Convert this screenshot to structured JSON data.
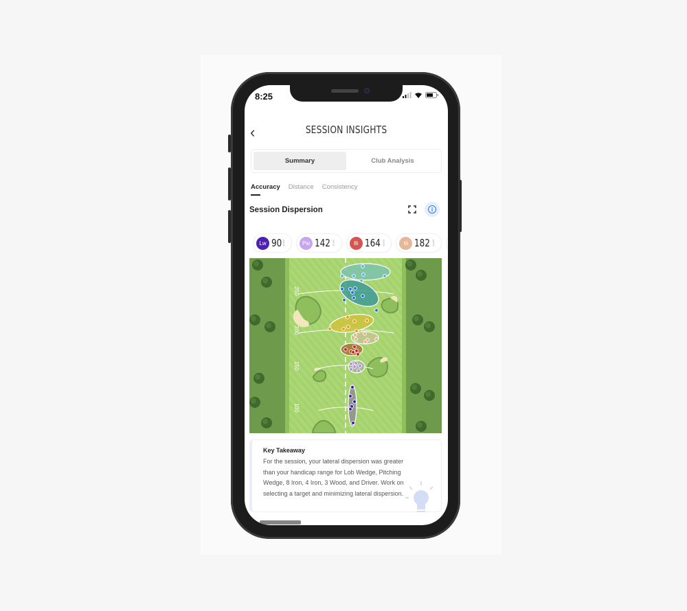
{
  "status_bar": {
    "time": "8:25"
  },
  "header": {
    "title": "SESSION INSIGHTS"
  },
  "segments": [
    {
      "label": "Summary",
      "active": true
    },
    {
      "label": "Club Analysis",
      "active": false
    }
  ],
  "subtabs": [
    {
      "label": "Accuracy",
      "active": true
    },
    {
      "label": "Distance",
      "active": false
    },
    {
      "label": "Consistency",
      "active": false
    }
  ],
  "section": {
    "title": "Session Dispersion"
  },
  "clubs": [
    {
      "code": "Lw",
      "yards": "90",
      "unit": "yards",
      "color": "#4b1fb8"
    },
    {
      "code": "Pw",
      "yards": "142",
      "unit": "yards",
      "color": "#c7a6ef"
    },
    {
      "code": "8i",
      "yards": "164",
      "unit": "yards",
      "color": "#d9534f"
    },
    {
      "code": "6i",
      "yards": "182",
      "unit": "yards",
      "color": "#e5b797"
    },
    {
      "code": "4i",
      "yards": "",
      "unit": "",
      "color": "#f5a623"
    }
  ],
  "map": {
    "yard_markers": [
      "250",
      "200",
      "150",
      "100"
    ]
  },
  "takeaway": {
    "title": "Key Takeaway",
    "body": "For the session, your lateral dispersion was greater than your handicap range for Lob Wedge, Pitching Wedge, 8 Iron, 4 Iron, 3 Wood, and Driver. Work on selecting a target and minimizing lateral dispersion."
  }
}
